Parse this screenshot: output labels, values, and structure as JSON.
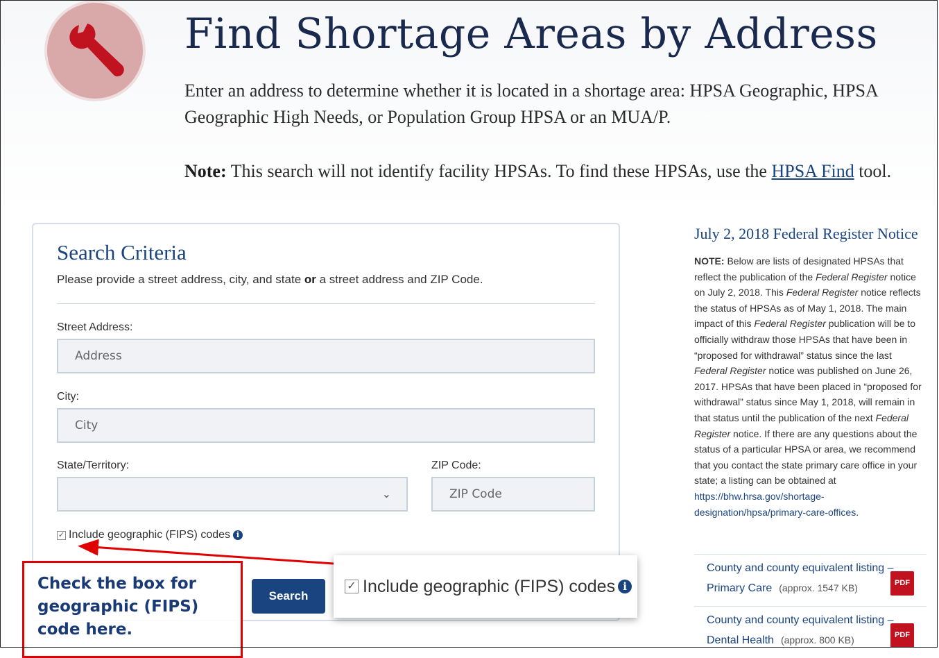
{
  "header": {
    "title": "Find Shortage Areas by Address",
    "intro": "Enter an address to determine whether it is located in a shortage area: HPSA Geographic, HPSA Geographic High Needs, or Population Group HPSA or an MUA/P.",
    "note_label": "Note:",
    "note_text_before": " This search will not identify facility HPSAs. To find these HPSAs, use the ",
    "note_link": "HPSA Find",
    "note_text_after": " tool."
  },
  "form": {
    "title": "Search Criteria",
    "subtitle_before": "Please provide a street address, city, and state ",
    "subtitle_bold": "or",
    "subtitle_after": " a street address and ZIP Code.",
    "street_label": "Street Address:",
    "street_placeholder": "Address",
    "city_label": "City:",
    "city_placeholder": "City",
    "state_label": "State/Territory:",
    "state_value": "",
    "zip_label": "ZIP Code:",
    "zip_placeholder": "ZIP Code",
    "fips_label": "Include geographic (FIPS) codes",
    "fips_checked": true,
    "search_label": "Search"
  },
  "callout": {
    "fips_label": "Include geographic (FIPS) codes"
  },
  "annotation": {
    "line1": "Check the box for",
    "line2": "geographic (FIPS)",
    "line3": "code here.",
    "border_color": "#e00000"
  },
  "sidebar": {
    "title": "July 2, 2018 Federal Register Notice",
    "note_label": "NOTE:",
    "note_p1": " Below are lists of designated HPSAs that reflect the publication of the ",
    "note_i1": "Federal Register",
    "note_p2": " notice on July 2, 2018. This ",
    "note_i2": "Federal Register",
    "note_p3": " notice reflects the status of HPSAs as of May 1, 2018. The main impact of this ",
    "note_i3": "Federal Register",
    "note_p4": " publication will be to officially withdraw those HPSAs that have been in “proposed for withdrawal” status since the last ",
    "note_i4": "Federal Register",
    "note_p5": " notice was published on June 26, 2017. HPSAs that have been placed in “proposed for withdrawal” status since May 1, 2018, will remain in that status until the publication of the next ",
    "note_i5": "Federal Register",
    "note_p6": " notice. If there are any questions about the status of a particular HPSA or area, we recommend that you contact the state primary care office in your state; a listing can be obtained at ",
    "note_link": "https://bhw.hrsa.gov/shortage-designation/hpsa/primary-care-offices",
    "note_end": ".",
    "downloads": [
      {
        "line1": "County and county equivalent listing –",
        "line2": "Primary Care",
        "size": "(approx. 1547 KB)",
        "badge": "PDF"
      },
      {
        "line1": "County and county equivalent listing –",
        "line2": "Dental Health",
        "size": "(approx. 800 KB)",
        "badge": "PDF"
      }
    ]
  },
  "colors": {
    "primary": "#1a4480",
    "title": "#1a2a4f",
    "pdf_badge": "#c1121f",
    "logo_bg": "#d9a9a9",
    "wrench": "#c1121f"
  }
}
